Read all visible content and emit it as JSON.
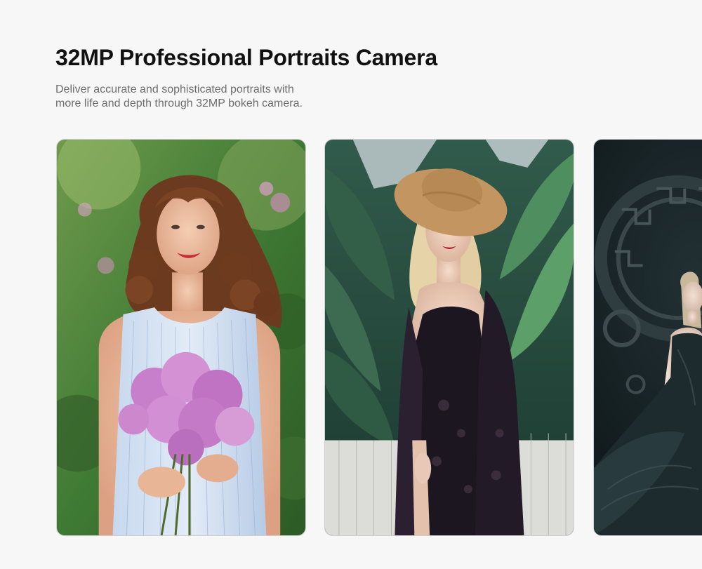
{
  "header": {
    "title": "32MP Professional Portraits Camera",
    "subtitle_line1": "Deliver accurate and sophisticated portraits with",
    "subtitle_line2": "more life and depth through 32MP bokeh camera."
  },
  "colors": {
    "background": "#f7f7f7",
    "title": "#111111",
    "subtitle": "#6e6e6e"
  },
  "gallery": {
    "photos": [
      {
        "name": "woman-with-lilac-bouquet-photo"
      },
      {
        "name": "woman-in-straw-hat-photo"
      },
      {
        "name": "woman-in-dark-gown-photo"
      }
    ]
  }
}
